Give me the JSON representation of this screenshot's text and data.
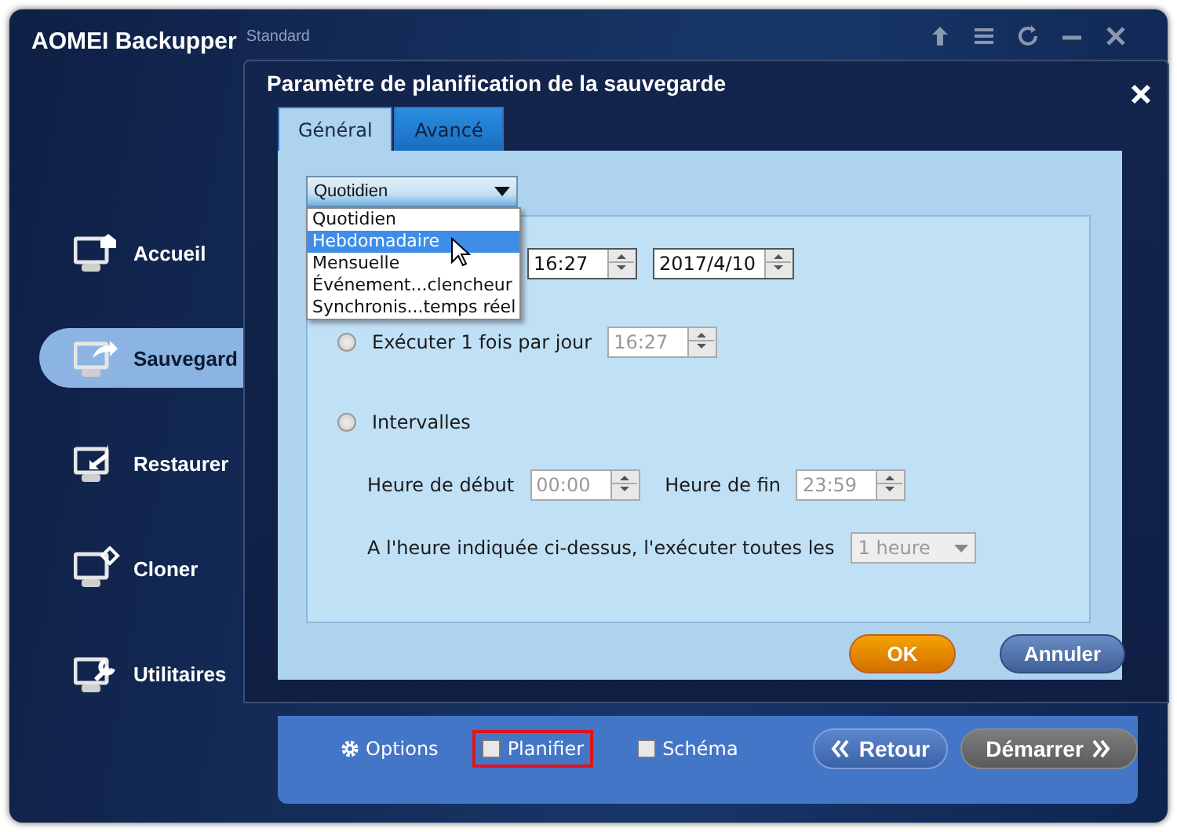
{
  "app": {
    "title": "AOMEI Backupper",
    "edition": "Standard"
  },
  "sidebar": {
    "items": [
      {
        "label": "Accueil",
        "selected": false
      },
      {
        "label": "Sauvegard",
        "selected": true
      },
      {
        "label": "Restaurer",
        "selected": false
      },
      {
        "label": "Cloner",
        "selected": false
      },
      {
        "label": "Utilitaires",
        "selected": false
      }
    ]
  },
  "dialog": {
    "title": "Paramètre de planification de la sauvegarde",
    "tabs": [
      {
        "label": "Général",
        "selected": true
      },
      {
        "label": "Avancé",
        "selected": false
      }
    ],
    "frequency": {
      "value": "Quotidien",
      "expanded": true,
      "options": [
        {
          "label": "Quotidien",
          "highlighted": false
        },
        {
          "label": "Hebdomadaire",
          "highlighted": true
        },
        {
          "label": "Mensuelle",
          "highlighted": false
        },
        {
          "label": "Événement...clencheur",
          "highlighted": false
        },
        {
          "label": "Synchronis...temps réel",
          "highlighted": false
        }
      ]
    },
    "start_time": {
      "value": "16:27",
      "disabled": false
    },
    "start_date": {
      "value": "2017/4/10",
      "disabled": false
    },
    "once_daily": {
      "label": "Exécuter 1 fois par jour",
      "checked": false,
      "time": {
        "value": "16:27",
        "disabled": true
      }
    },
    "intervals": {
      "label": "Intervalles",
      "checked": false,
      "start_label": "Heure de début",
      "start": {
        "value": "00:00",
        "disabled": true
      },
      "end_label": "Heure de fin",
      "end": {
        "value": "23:59",
        "disabled": true
      },
      "repeat_label": "A l'heure indiquée ci-dessus, l'exécuter toutes les",
      "repeat": {
        "value": "1 heure",
        "disabled": true
      }
    },
    "buttons": [
      {
        "label": "OK",
        "kind": "primary"
      },
      {
        "label": "Annuler",
        "kind": "secondary"
      }
    ]
  },
  "bottom_bar": {
    "options_label": "Options",
    "checkboxes": [
      {
        "label": "Planifier",
        "checked": false,
        "highlighted": true
      },
      {
        "label": "Schéma",
        "checked": false,
        "highlighted": false
      }
    ],
    "back": "Retour",
    "start": "Démarrer"
  }
}
